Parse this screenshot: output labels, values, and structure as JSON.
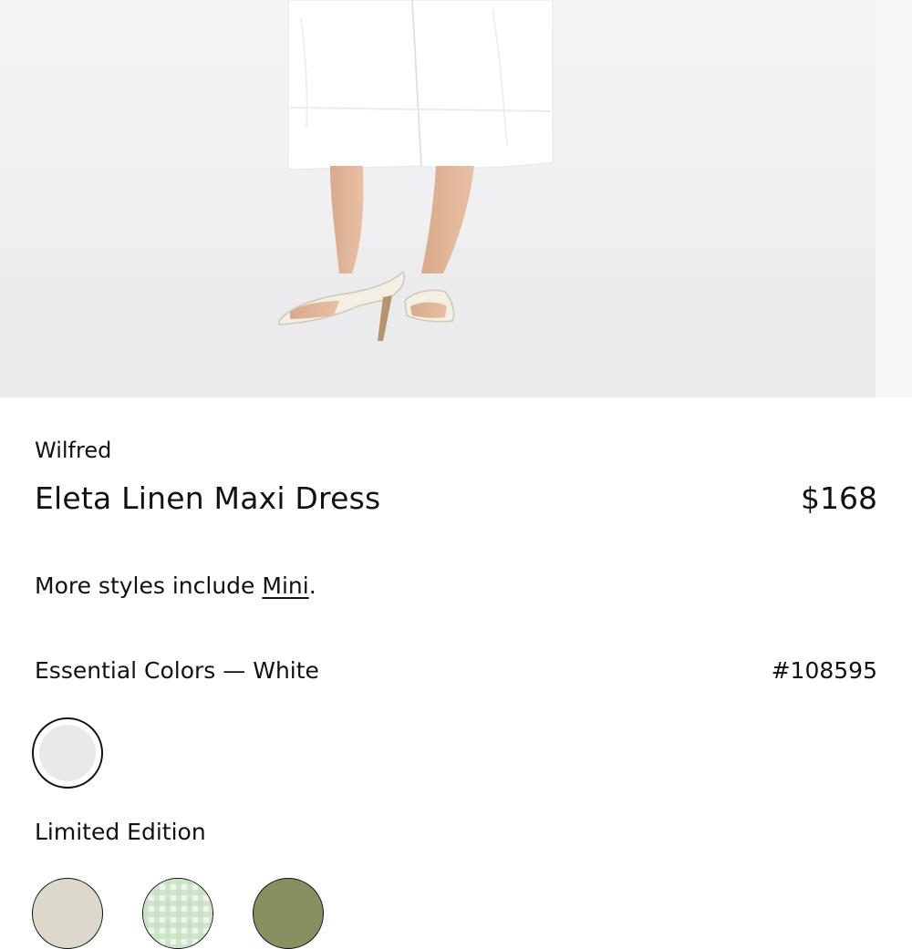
{
  "product": {
    "brand": "Wilfred",
    "name": "Eleta Linen Maxi Dress",
    "price": "$168"
  },
  "more_styles": {
    "prefix": "More styles include ",
    "link_label": "Mini",
    "suffix": "."
  },
  "colors": {
    "group_label": "Essential Colors — White",
    "style_number": "#108595",
    "essential_swatches": [
      {
        "name": "White",
        "color": "#e9e9e9",
        "selected": true
      }
    ],
    "limited_label": "Limited Edition",
    "limited_swatches": [
      {
        "color": "#ddd8cc",
        "pattern": "solid"
      },
      {
        "color": "#cfe4cc",
        "pattern": "gingham"
      },
      {
        "color": "#8a8f62",
        "pattern": "solid"
      }
    ]
  }
}
